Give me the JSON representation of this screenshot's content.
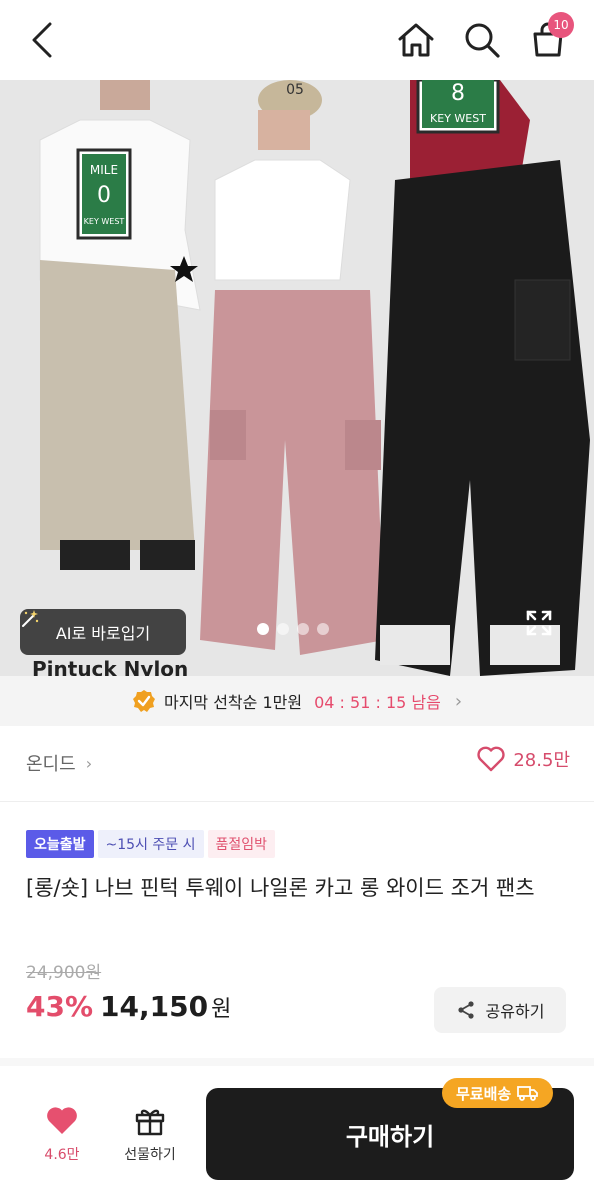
{
  "nav": {
    "icons": [
      "chevron-left-icon",
      "home-icon",
      "search-icon",
      "shopping-bag-icon"
    ],
    "cart_count": "10"
  },
  "hero": {
    "ai_button_label": "AI로 바로입기",
    "slide_count": 4,
    "active_slide": 1,
    "image_text": {
      "sign_left": "MILE",
      "sign_left_number": "0",
      "sign_left_bottom": "KEY WEST",
      "sign_right_number": "8",
      "sign_right_bottom": "KEY WEST",
      "cap": "05",
      "corner_text": "Pintuck Nylon"
    }
  },
  "countdown": {
    "text": "마지막 선착순 1만원",
    "time": "04 : 51 : 15 남음"
  },
  "store": {
    "name": "온디드",
    "likes": "28.5만"
  },
  "tags": {
    "today": "오늘출발",
    "cutoff": "~15시 주문 시",
    "soldout": "품절임박"
  },
  "product": {
    "title": "[롱/숏] 나브 핀턱 투웨이 나일론 카고 롱 와이드 조거 팬츠",
    "original_price": "24,900원",
    "discount": "43%",
    "price": "14,150",
    "price_unit": "원"
  },
  "share_label": "공유하기",
  "bottom": {
    "wish_count": "4.6만",
    "gift_label": "선물하기",
    "buy_label": "구매하기",
    "shipping_badge": "무료배송"
  },
  "colors": {
    "accent_pink": "#e34d6b",
    "tag_blue": "#5b5be8",
    "badge_orange": "#f5a623",
    "buy_button": "#1c1c1c"
  }
}
